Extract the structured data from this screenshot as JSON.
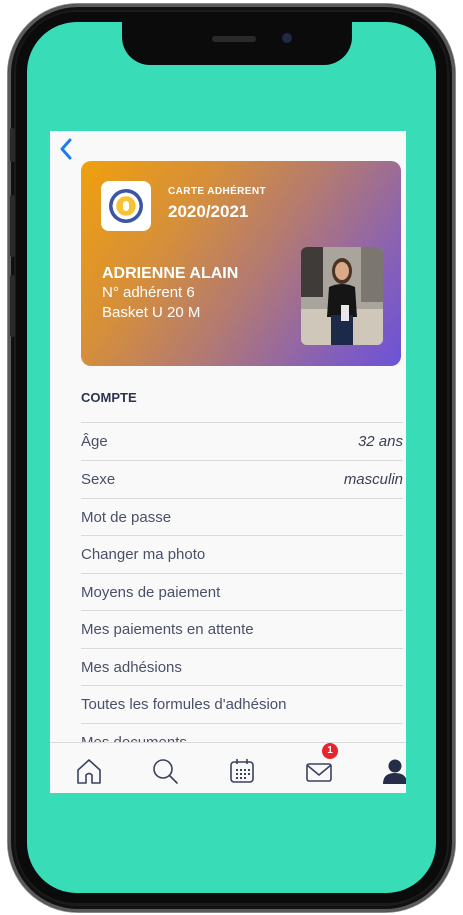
{
  "card": {
    "label": "CARTE ADHÉRENT",
    "season": "2020/2021",
    "name": "ADRIENNE ALAIN",
    "number": "N° adhérent 6",
    "team": "Basket U 20 M"
  },
  "account": {
    "title": "COMPTE",
    "rows": [
      {
        "label": "Âge",
        "value": "32 ans"
      },
      {
        "label": "Sexe",
        "value": "masculin"
      },
      {
        "label": "Mot de passe",
        "value": ""
      },
      {
        "label": "Changer ma photo",
        "value": ""
      },
      {
        "label": "Moyens de paiement",
        "value": ""
      },
      {
        "label": "Mes paiements en attente",
        "value": ""
      },
      {
        "label": "Mes adhésions",
        "value": ""
      },
      {
        "label": "Toutes les formules d'adhésion",
        "value": ""
      },
      {
        "label": "Mes documents",
        "value": ""
      }
    ]
  },
  "tabbar": {
    "items": [
      "home-icon",
      "search-icon",
      "calendar-icon",
      "mail-icon",
      "profile-icon"
    ],
    "mail_badge": "1",
    "active": "profile-icon"
  },
  "colors": {
    "screen_background": "#38DDB8",
    "accent_blue": "#1F7BF5",
    "badge_red": "#E8232C",
    "text_dark": "#2B3450"
  }
}
